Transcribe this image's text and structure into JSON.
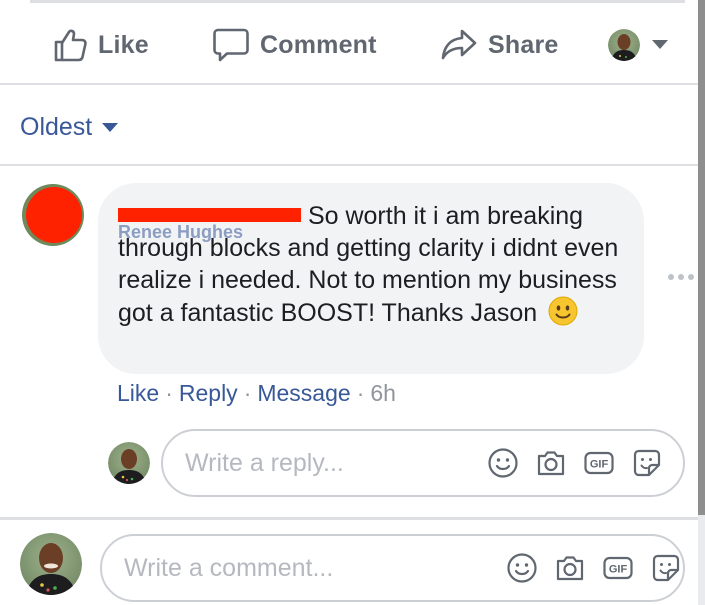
{
  "actions": {
    "like_label": "Like",
    "comment_label": "Comment",
    "share_label": "Share"
  },
  "sort": {
    "label": "Oldest"
  },
  "comment": {
    "author": "Renee Hughes",
    "text": "So worth it i am breaking through blocks and getting clarity i didnt even realize i needed. Not to mention my business got a fantastic BOOST! Thanks Jason",
    "emoji": "slightly-smiling-face",
    "actions": {
      "like": "Like",
      "reply": "Reply",
      "message": "Message"
    },
    "separator": "·",
    "time": "6h"
  },
  "reply_box": {
    "placeholder": "Write a reply..."
  },
  "comment_box": {
    "placeholder": "Write a comment..."
  },
  "icons": {
    "like": "thumbs-up-icon",
    "comment": "speech-bubble-icon",
    "share": "share-arrow-icon",
    "dropdown": "caret-down-icon",
    "emoji": "emoji-icon",
    "camera": "camera-icon",
    "gif": "gif-icon",
    "sticker": "sticker-icon"
  },
  "colors": {
    "link": "#385898",
    "muted_text": "#606770",
    "bubble_bg": "#f2f3f5",
    "border": "#ccd0d5",
    "redaction": "#fe2200"
  }
}
